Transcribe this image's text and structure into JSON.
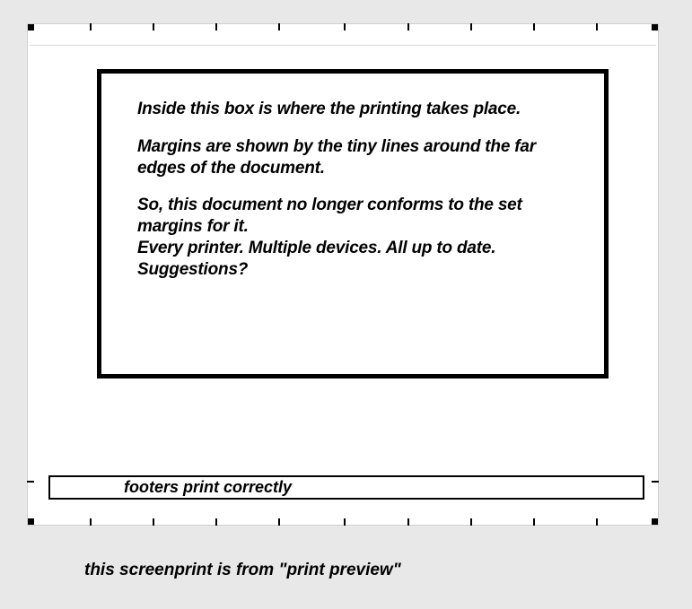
{
  "content": {
    "p1": "Inside this box is where the printing takes place.",
    "p2": "Margins are shown by the tiny lines around the far edges of the document.",
    "p3": "So, this document no longer conforms to the set margins for it.\nEvery printer. Multiple devices. All up to date.\nSuggestions?"
  },
  "footer": {
    "text": "footers print correctly"
  },
  "caption": "this screenprint is from \"print preview\""
}
